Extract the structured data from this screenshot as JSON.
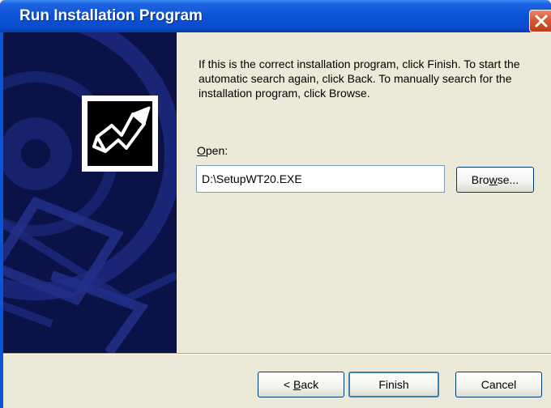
{
  "window": {
    "title": "Run Installation Program"
  },
  "content": {
    "instructions": "If this is the correct installation program, click Finish. To start the automatic search again, click Back. To manually search for the installation program, click Browse.",
    "open_label_accel": "O",
    "open_label_rest": "pen:",
    "path_value": "D:\\SetupWT20.EXE"
  },
  "buttons": {
    "browse_accel": "w",
    "browse_pre": "Bro",
    "browse_post": "se...",
    "back_pre": "< ",
    "back_accel": "B",
    "back_post": "ack",
    "finish": "Finish",
    "cancel": "Cancel"
  },
  "icons": {
    "close": "close-icon",
    "setup": "setup-arrow-icon",
    "banner": "cd-disc-banner"
  },
  "colors": {
    "titlebar": "#0a54d8",
    "banner": "#0a1248",
    "dialog_bg": "#ece9d8",
    "close_button": "#d35a34"
  }
}
